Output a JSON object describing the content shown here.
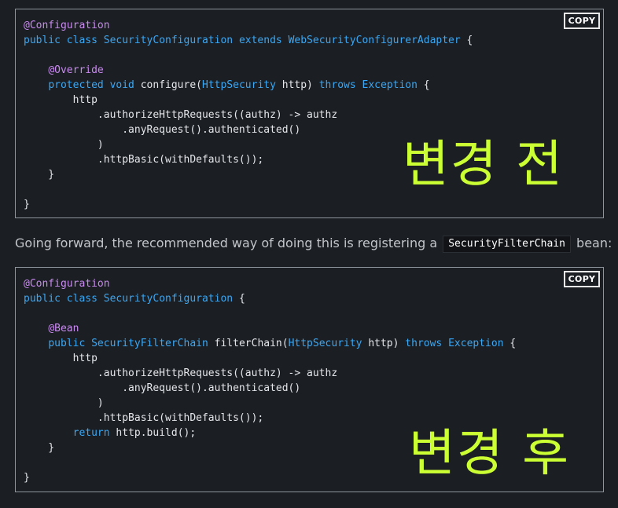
{
  "blocks": {
    "before": {
      "copy_label": "COPY",
      "overlay_label": "변경 전",
      "lines": [
        [
          {
            "t": "ann",
            "v": "@Configuration"
          }
        ],
        [
          {
            "t": "kw",
            "v": "public class "
          },
          {
            "t": "type",
            "v": "SecurityConfiguration "
          },
          {
            "t": "kw",
            "v": "extends "
          },
          {
            "t": "type",
            "v": "WebSecurityConfigurerAdapter"
          },
          {
            "t": "plain",
            "v": " {"
          }
        ],
        [],
        [
          {
            "t": "plain",
            "v": "    "
          },
          {
            "t": "ann",
            "v": "@Override"
          }
        ],
        [
          {
            "t": "plain",
            "v": "    "
          },
          {
            "t": "kw",
            "v": "protected void "
          },
          {
            "t": "plain",
            "v": "configure("
          },
          {
            "t": "type",
            "v": "HttpSecurity"
          },
          {
            "t": "plain",
            "v": " http) "
          },
          {
            "t": "kw",
            "v": "throws "
          },
          {
            "t": "type",
            "v": "Exception"
          },
          {
            "t": "plain",
            "v": " {"
          }
        ],
        [
          {
            "t": "plain",
            "v": "        http"
          }
        ],
        [
          {
            "t": "plain",
            "v": "            .authorizeHttpRequests((authz) -> authz"
          }
        ],
        [
          {
            "t": "plain",
            "v": "                .anyRequest().authenticated()"
          }
        ],
        [
          {
            "t": "plain",
            "v": "            )"
          }
        ],
        [
          {
            "t": "plain",
            "v": "            .httpBasic(withDefaults());"
          }
        ],
        [
          {
            "t": "plain",
            "v": "    }"
          }
        ],
        [],
        [
          {
            "t": "plain",
            "v": "}"
          }
        ]
      ]
    },
    "after": {
      "copy_label": "COPY",
      "overlay_label": "변경 후",
      "lines": [
        [
          {
            "t": "ann",
            "v": "@Configuration"
          }
        ],
        [
          {
            "t": "kw",
            "v": "public class "
          },
          {
            "t": "type",
            "v": "SecurityConfiguration"
          },
          {
            "t": "plain",
            "v": " {"
          }
        ],
        [],
        [
          {
            "t": "plain",
            "v": "    "
          },
          {
            "t": "ann",
            "v": "@Bean"
          }
        ],
        [
          {
            "t": "plain",
            "v": "    "
          },
          {
            "t": "kw",
            "v": "public "
          },
          {
            "t": "type",
            "v": "SecurityFilterChain"
          },
          {
            "t": "plain",
            "v": " filterChain("
          },
          {
            "t": "type",
            "v": "HttpSecurity"
          },
          {
            "t": "plain",
            "v": " http) "
          },
          {
            "t": "kw",
            "v": "throws "
          },
          {
            "t": "type",
            "v": "Exception"
          },
          {
            "t": "plain",
            "v": " {"
          }
        ],
        [
          {
            "t": "plain",
            "v": "        http"
          }
        ],
        [
          {
            "t": "plain",
            "v": "            .authorizeHttpRequests((authz) -> authz"
          }
        ],
        [
          {
            "t": "plain",
            "v": "                .anyRequest().authenticated()"
          }
        ],
        [
          {
            "t": "plain",
            "v": "            )"
          }
        ],
        [
          {
            "t": "plain",
            "v": "            .httpBasic(withDefaults());"
          }
        ],
        [
          {
            "t": "plain",
            "v": "        "
          },
          {
            "t": "kw",
            "v": "return "
          },
          {
            "t": "plain",
            "v": "http.build();"
          }
        ],
        [
          {
            "t": "plain",
            "v": "    }"
          }
        ],
        [],
        [
          {
            "t": "plain",
            "v": "}"
          }
        ]
      ]
    }
  },
  "prose": {
    "before_text": "Going forward, the recommended way of doing this is registering a",
    "inline_code": "SecurityFilterChain",
    "after_text": "bean:"
  },
  "colors": {
    "background": "#1b1e23",
    "annotation": "#c98bf0",
    "keyword": "#3aa8f5",
    "plain": "#e4e6ea",
    "overlay": "#ccff33",
    "prose": "#c2c5ca"
  }
}
